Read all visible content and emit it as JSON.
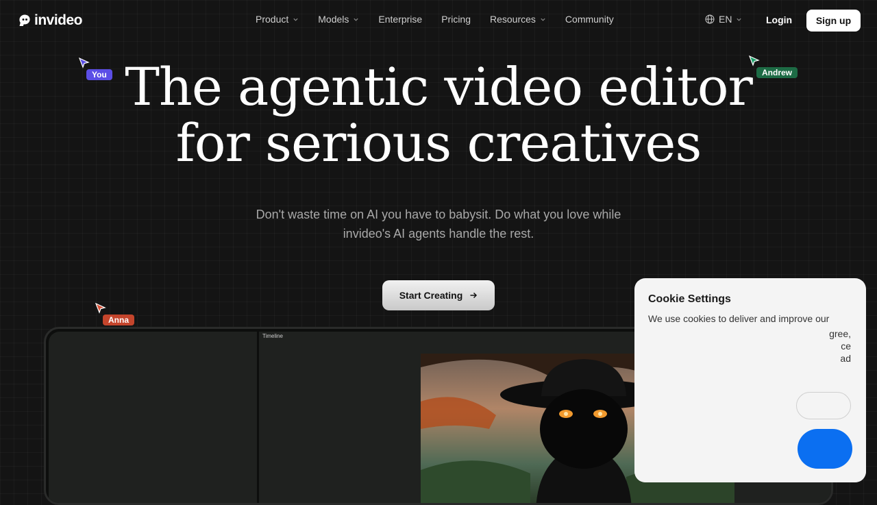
{
  "brand": {
    "name": "invideo"
  },
  "nav": {
    "items": [
      {
        "label": "Product",
        "dropdown": true
      },
      {
        "label": "Models",
        "dropdown": true
      },
      {
        "label": "Enterprise",
        "dropdown": false
      },
      {
        "label": "Pricing",
        "dropdown": false
      },
      {
        "label": "Resources",
        "dropdown": true
      },
      {
        "label": "Community",
        "dropdown": false
      }
    ],
    "language": "EN",
    "login": "Login",
    "signup": "Sign up"
  },
  "hero": {
    "title_line1": "The agentic video editor",
    "title_line2": "for serious creatives",
    "subtitle_line1": "Don't waste time on AI you have to babysit. Do what you love while",
    "subtitle_line2": "invideo's AI agents handle the rest.",
    "cta": "Start Creating"
  },
  "cursors": [
    {
      "name": "You",
      "color": "#5b4ee6"
    },
    {
      "name": "Andrew",
      "color": "#1d6b45"
    },
    {
      "name": "Anna",
      "color": "#c4452c"
    }
  ],
  "editor": {
    "timeline_label": "Timeline"
  },
  "cookie": {
    "title": "Cookie Settings",
    "text_line1": "We use cookies to deliver and improve our",
    "frag1": "gree,",
    "frag2": "ce",
    "frag3": "ad"
  },
  "colors": {
    "accent_blue": "#0b6ff1",
    "background": "#141414"
  }
}
